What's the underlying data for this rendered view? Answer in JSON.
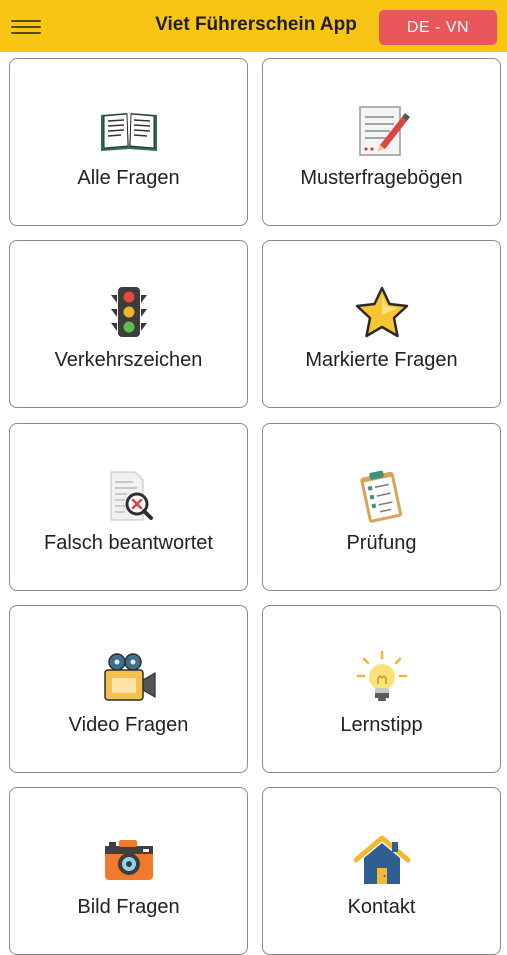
{
  "header": {
    "title": "Viet Führerschein App",
    "lang_label": "DE - VN"
  },
  "tiles": [
    {
      "label": "Alle Fragen",
      "icon": "book-icon"
    },
    {
      "label": "Musterfragebögen",
      "icon": "notepad-pencil-icon"
    },
    {
      "label": "Verkehrszeichen",
      "icon": "traffic-light-icon"
    },
    {
      "label": "Markierte Fragen",
      "icon": "star-icon"
    },
    {
      "label": "Falsch beantwortet",
      "icon": "document-wrong-icon"
    },
    {
      "label": "Prüfung",
      "icon": "clipboard-checklist-icon"
    },
    {
      "label": "Video Fragen",
      "icon": "video-camera-icon"
    },
    {
      "label": "Lernstipp",
      "icon": "lightbulb-icon"
    },
    {
      "label": "Bild Fragen",
      "icon": "photo-camera-icon"
    },
    {
      "label": "Kontakt",
      "icon": "house-icon"
    }
  ],
  "colors": {
    "header_bg": "#f9c515",
    "lang_button_bg": "#e8585a"
  }
}
